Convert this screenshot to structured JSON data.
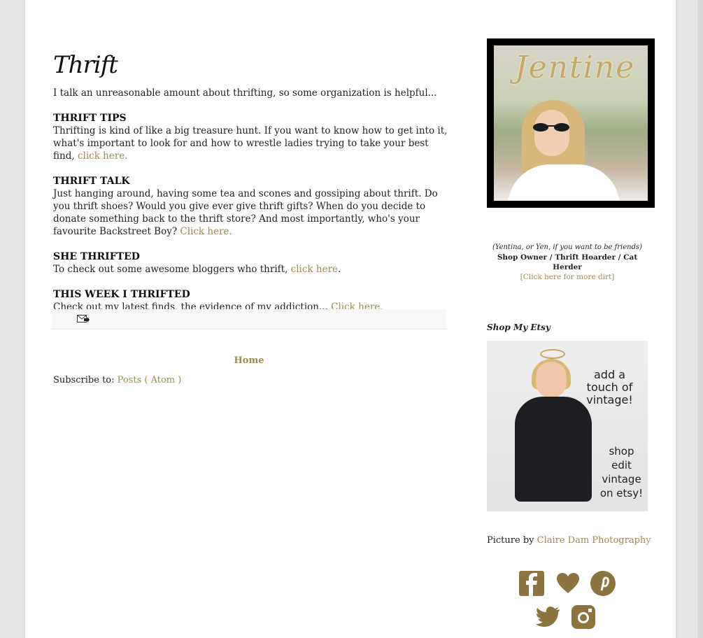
{
  "page": {
    "title": "Thrift",
    "intro": "I talk an unreasonable amount about thrifting, so some organization is helpful..."
  },
  "sections": [
    {
      "heading": "THRIFT TIPS",
      "text": "Thrifting is kind of like a big treasure hunt. If you want to know how to get into it, what's important to look for and how to wrestle ladies trying to take your best find, ",
      "link": "click here."
    },
    {
      "heading": "THRIFT TALK",
      "text": "Just hanging around, having some tea and scones and gossiping about thrift. Do you thrift shoes? Would you give ever give thrift gifts? When do you decide to donate something back to the thrift store? And most importantly, who's your favourite Backstreet Boy? ",
      "link": "Click here."
    },
    {
      "heading": "SHE THRIFTED",
      "text": "To check out some awesome bloggers who thrift, ",
      "link": "click here",
      "after": "."
    },
    {
      "heading": "THIS WEEK I THRIFTED",
      "text": "Check out my latest finds, the evidence of my addiction... ",
      "link": "Click here."
    }
  ],
  "footer": {
    "home_label": "Home",
    "subscribe_label": "Subscribe to: ",
    "subscribe_link": "Posts ( Atom )"
  },
  "sidebar": {
    "profile_signature": "Jentine",
    "caption_1": "(Yentina, or Yen, if you want to be friends)",
    "caption_2": "Shop Owner / Thrift Hoarder / Cat Herder",
    "caption_3": "[Click here for more dirt]",
    "etsy_title": "Shop My Etsy",
    "etsy_text_1": "add a touch of vintage!",
    "etsy_text_2": "shop edit vintage on etsy!",
    "credit_label": "Picture by ",
    "credit_link": "Claire Dam Photography"
  },
  "social": [
    "facebook-icon",
    "bloglovin-heart-icon",
    "pinterest-icon",
    "twitter-icon",
    "instagram-icon"
  ],
  "colors": {
    "link": "#9c8a4f",
    "glitter": "#8c7440"
  }
}
